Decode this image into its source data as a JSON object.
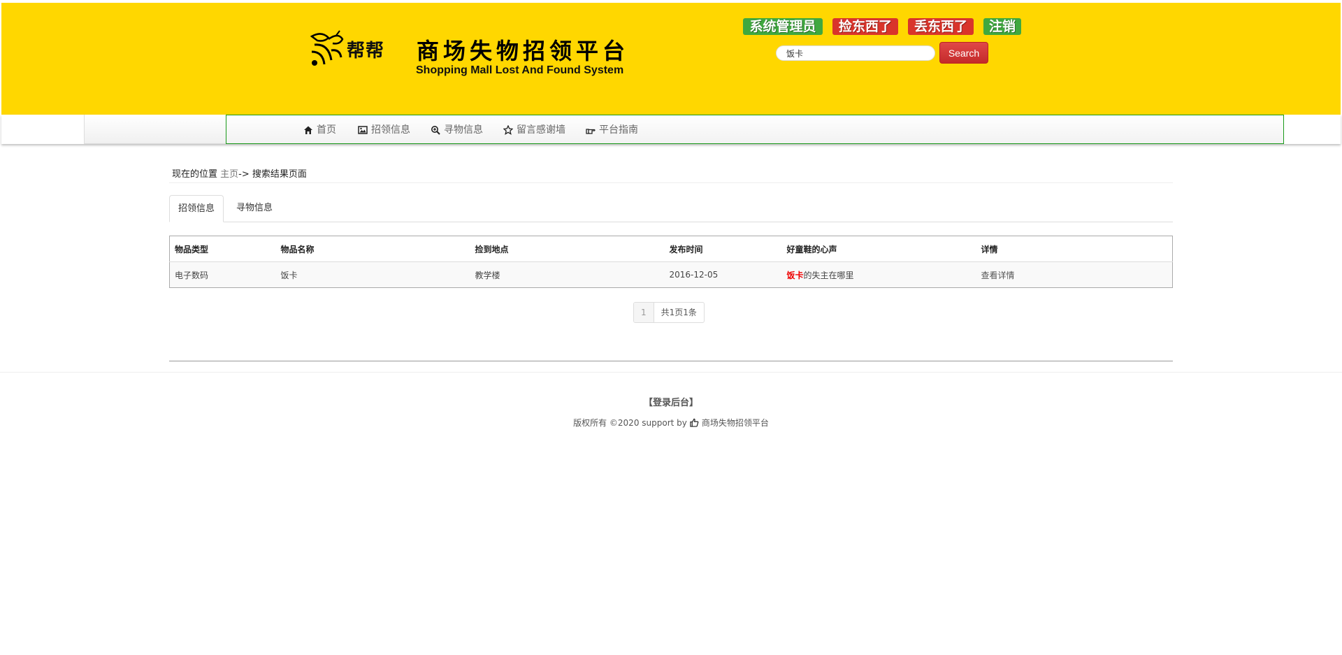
{
  "header": {
    "logo_text": "帮帮",
    "title_cn": "商场失物招领平台",
    "title_en": "Shopping Mall Lost And Found System",
    "buttons": {
      "admin": "系统管理员",
      "found": "捡东西了",
      "lost": "丢东西了",
      "logout": "注销"
    },
    "search": {
      "value": "饭卡",
      "button": "Search"
    },
    "colors": {
      "background": "#FFD700",
      "green_button": "#3fa83f",
      "red_button": "#d9342b"
    }
  },
  "nav": {
    "items": [
      {
        "label": "首页",
        "icon": "home-icon"
      },
      {
        "label": "招领信息",
        "icon": "picture-icon"
      },
      {
        "label": "寻物信息",
        "icon": "zoom-in-icon"
      },
      {
        "label": "留言感谢墙",
        "icon": "star-icon"
      },
      {
        "label": "平台指南",
        "icon": "hand-right-icon"
      }
    ]
  },
  "breadcrumb": {
    "prefix": "现在的位置",
    "home": "主页",
    "sep": "->",
    "current": "搜索结果页面"
  },
  "tabs": [
    {
      "label": "招领信息",
      "active": true
    },
    {
      "label": "寻物信息",
      "active": false
    }
  ],
  "table": {
    "headers": [
      "物品类型",
      "物品名称",
      "捡到地点",
      "发布时间",
      "好童鞋的心声",
      "详情"
    ],
    "rows": [
      {
        "type": "电子数码",
        "name": "饭卡",
        "place": "教学楼",
        "date": "2016-12-05",
        "voice_highlight": "饭卡",
        "voice_rest": "的失主在哪里",
        "detail": "查看详情"
      }
    ]
  },
  "pager": {
    "current": "1",
    "summary": "共1页1条"
  },
  "footer": {
    "login": "【登录后台】",
    "copyright": "版权所有 ©2020 support by",
    "platform": "商场失物招领平台"
  }
}
